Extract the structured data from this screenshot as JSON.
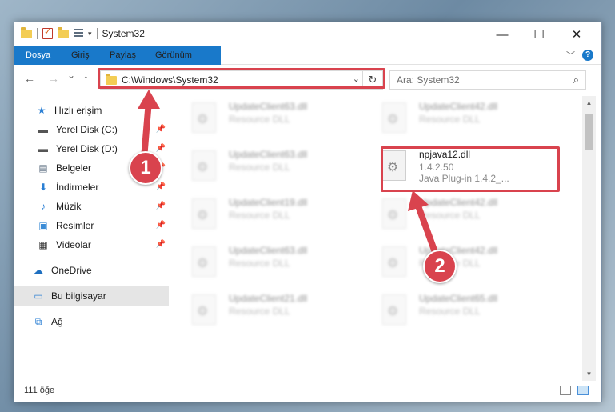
{
  "window": {
    "title": "System32",
    "minimize": "—",
    "maximize": "☐",
    "close": "✕"
  },
  "ribbon": {
    "tabs": [
      "Dosya",
      "Giriş",
      "Paylaş",
      "Görünüm"
    ],
    "help": "?",
    "expand": "﹀"
  },
  "nav": {
    "back": "←",
    "forward": "→",
    "recent": "⌄",
    "up": "↑"
  },
  "address": {
    "path": "C:\\Windows\\System32",
    "dropdown": "⌄",
    "refresh": "↻"
  },
  "search": {
    "placeholder": "Ara: System32",
    "icon": "⌕"
  },
  "sidebar": {
    "items": [
      {
        "label": "Hızlı erişim",
        "icon": "★",
        "pinned": false
      },
      {
        "label": "Yerel Disk (C:)",
        "icon": "▬",
        "pinned": true
      },
      {
        "label": "Yerel Disk (D:)",
        "icon": "▬",
        "pinned": true
      },
      {
        "label": "Belgeler",
        "icon": "▤",
        "pinned": true
      },
      {
        "label": "İndirmeler",
        "icon": "⬇",
        "pinned": true
      },
      {
        "label": "Müzik",
        "icon": "♪",
        "pinned": true
      },
      {
        "label": "Resimler",
        "icon": "▣",
        "pinned": true
      },
      {
        "label": "Videolar",
        "icon": "▦",
        "pinned": true
      },
      {
        "label": "OneDrive",
        "icon": "☁",
        "pinned": false
      },
      {
        "label": "Bu bilgisayar",
        "icon": "▭",
        "pinned": false
      },
      {
        "label": "Ağ",
        "icon": "⧉",
        "pinned": false
      }
    ],
    "pin_glyph": "📌"
  },
  "files": [
    {
      "name": "UpdateClient63.dll",
      "desc": "Resource DLL"
    },
    {
      "name": "UpdateClient42.dll",
      "desc": "Resource DLL"
    },
    {
      "name": "UpdateClient63.dll",
      "desc": "Resource DLL"
    },
    {
      "name": "npjava12.dll",
      "version": "1.4.2.50",
      "desc": "Java Plug-in 1.4.2_..."
    },
    {
      "name": "UpdateClient19.dll",
      "desc": "Resource DLL"
    },
    {
      "name": "UpdateClient42.dll",
      "desc": "Resource DLL"
    },
    {
      "name": "UpdateClient63.dll",
      "desc": "Resource DLL"
    },
    {
      "name": "UpdateClient42.dll",
      "desc": "Resource DLL"
    },
    {
      "name": "UpdateClient21.dll",
      "desc": "Resource DLL"
    },
    {
      "name": "UpdateClient65.dll",
      "desc": "Resource DLL"
    }
  ],
  "status": {
    "count": "111 öğe"
  },
  "annotations": {
    "step1": "1",
    "step2": "2",
    "color": "#d9434e"
  }
}
